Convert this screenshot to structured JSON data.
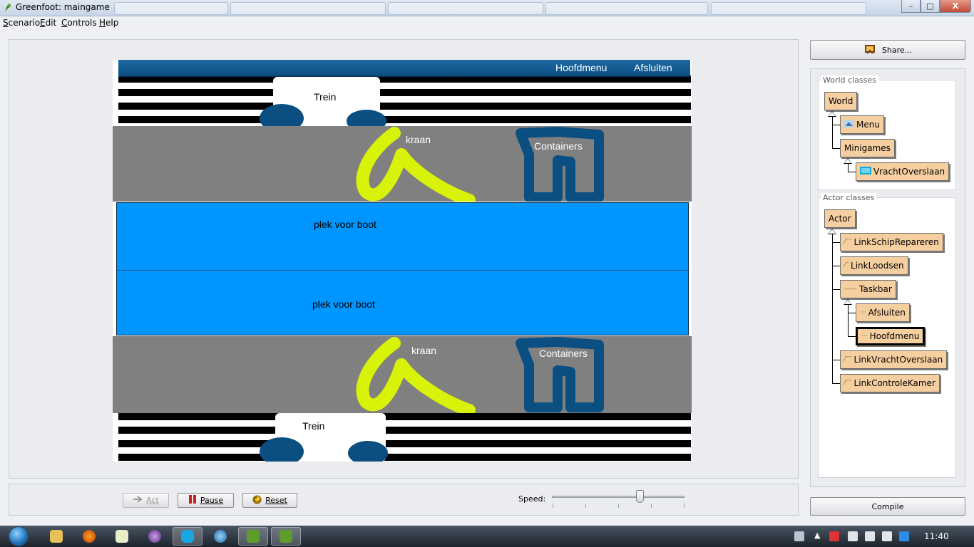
{
  "window": {
    "title": "Greenfoot: maingame",
    "background_tabs": [
      "",
      "",
      "",
      "",
      "",
      "",
      ""
    ],
    "controls": {
      "minimize": "–",
      "maximize": "□",
      "close": "X"
    }
  },
  "menubar": {
    "items": [
      "Scenario",
      "Edit",
      "Controls",
      "Help"
    ]
  },
  "world": {
    "taskbar_links": [
      "Hoofdmenu",
      "Afsluiten"
    ],
    "labels": {
      "trein_top": "Trein",
      "kraan_top": "kraan",
      "containers_top": "Containers",
      "boat_1": "plek voor boot",
      "boat_2": "plek voor boot",
      "kraan_bottom": "kraan",
      "containers_bottom": "Containers",
      "trein_bottom": "Trein"
    },
    "colors": {
      "water": "#0096ff",
      "quay": "#808080",
      "crane": "#d8f20a",
      "container": "#0b4f82",
      "taskbar": "#0d4f82"
    }
  },
  "controls": {
    "act_label": "Act",
    "pause_label": "Pause",
    "reset_label": "Reset",
    "speed_label": "Speed:",
    "speed_value": 0.66
  },
  "right_panel": {
    "share_label": "Share...",
    "world_classes_title": "World classes",
    "actor_classes_title": "Actor classes",
    "world_classes": [
      "World",
      "Menu",
      "Minigames",
      "VrachtOverslaan"
    ],
    "actor_classes": [
      "Actor",
      "LinkSchipRepareren",
      "LinkLoodsen",
      "Taskbar",
      "Afsluiten",
      "Hoofdmenu",
      "LinkVrachtOverslaan",
      "LinkControleKamer"
    ],
    "selected_class": "Hoofdmenu",
    "compile_label": "Compile"
  },
  "win_taskbar": {
    "clock": "11:40"
  }
}
